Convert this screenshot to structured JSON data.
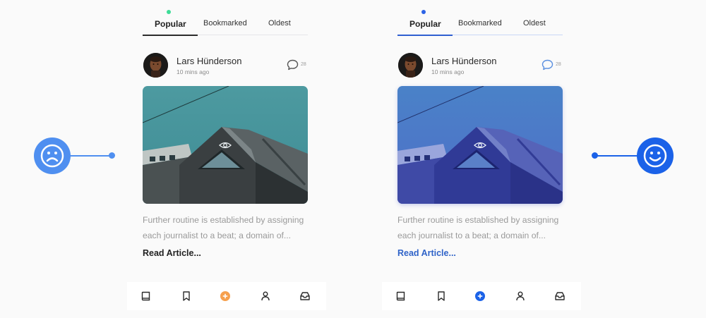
{
  "tabs": {
    "popular": "Popular",
    "bookmarked": "Bookmarked",
    "oldest": "Oldest"
  },
  "post": {
    "author": "Lars Hünderson",
    "time": "10 mins ago",
    "comments": "28",
    "excerpt_line1": "Further routine is established by assigning",
    "excerpt_line2": "each journalist to a beat; a domain of...",
    "read_more": "Read Article..."
  },
  "nav": {
    "items": [
      "book-icon",
      "bookmark-icon",
      "add-icon",
      "profile-icon",
      "inbox-icon"
    ],
    "add_color_left": "#f6a04d",
    "add_color_right": "#1b62e8"
  },
  "indicators": {
    "left": "sad-face-icon",
    "right": "happy-face-icon"
  },
  "colors": {
    "left_accent": "#2b2b2b",
    "left_dot": "#3ddc97",
    "right_accent": "#2f63c8",
    "sad_face": "#4f8ff0",
    "happy_face": "#1b62e8"
  }
}
